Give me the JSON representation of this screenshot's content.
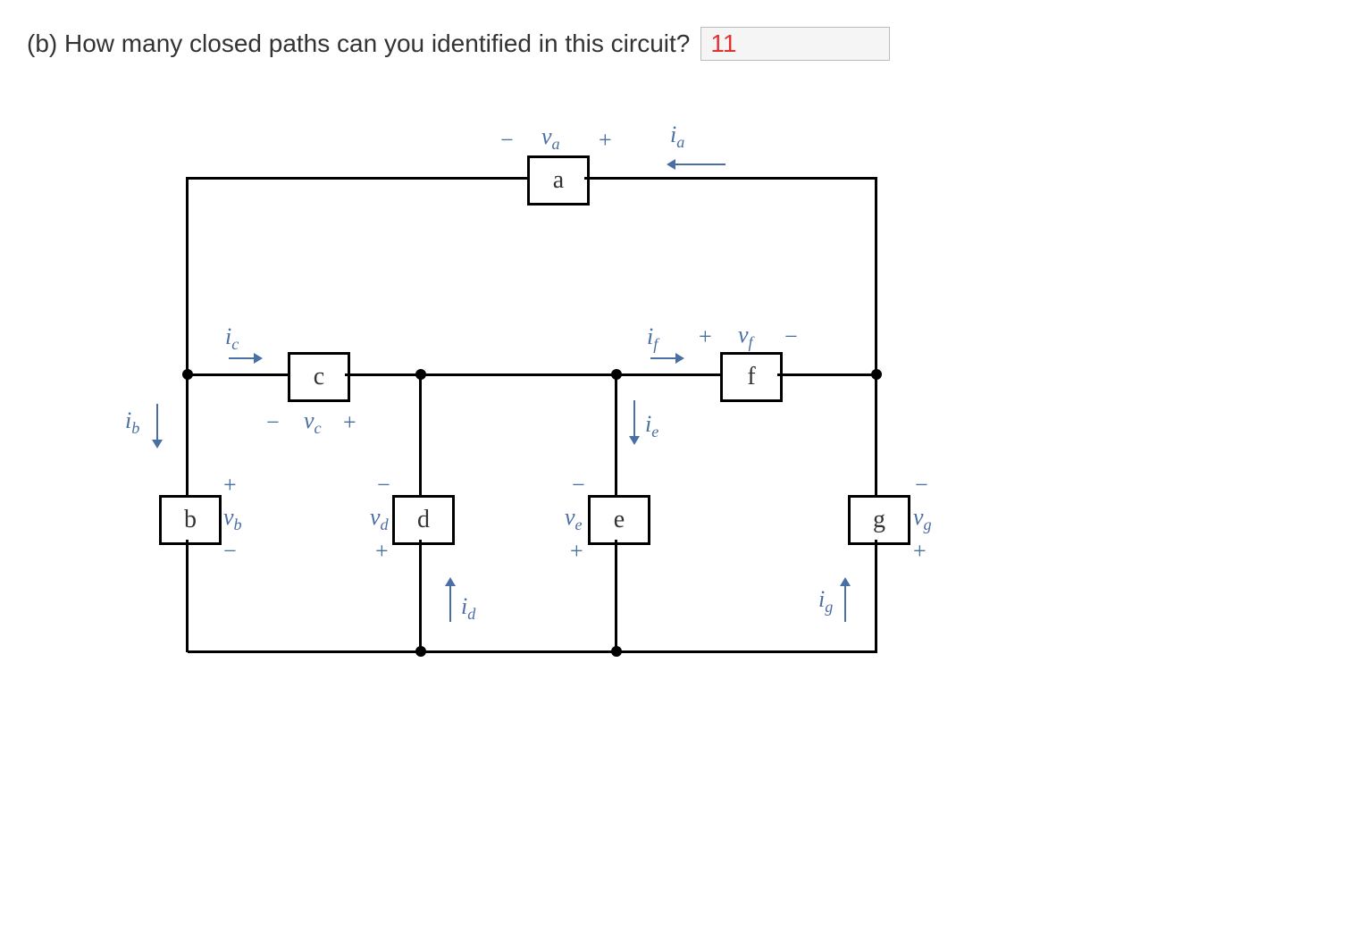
{
  "question": {
    "text": "(b) How many closed paths can you identified in this circuit?",
    "answer": "11"
  },
  "components": {
    "a": "a",
    "b": "b",
    "c": "c",
    "d": "d",
    "e": "e",
    "f": "f",
    "g": "g"
  },
  "voltages": {
    "va": "v",
    "va_sub": "a",
    "vb": "v",
    "vb_sub": "b",
    "vc": "v",
    "vc_sub": "c",
    "vd": "v",
    "vd_sub": "d",
    "ve": "v",
    "ve_sub": "e",
    "vf": "v",
    "vf_sub": "f",
    "vg": "v",
    "vg_sub": "g"
  },
  "currents": {
    "ia": "i",
    "ia_sub": "a",
    "ib": "i",
    "ib_sub": "b",
    "ic": "i",
    "ic_sub": "c",
    "id": "i",
    "id_sub": "d",
    "ie": "i",
    "ie_sub": "e",
    "if": "i",
    "if_sub": "f",
    "ig": "i",
    "ig_sub": "g"
  },
  "signs": {
    "plus": "+",
    "minus": "−"
  }
}
